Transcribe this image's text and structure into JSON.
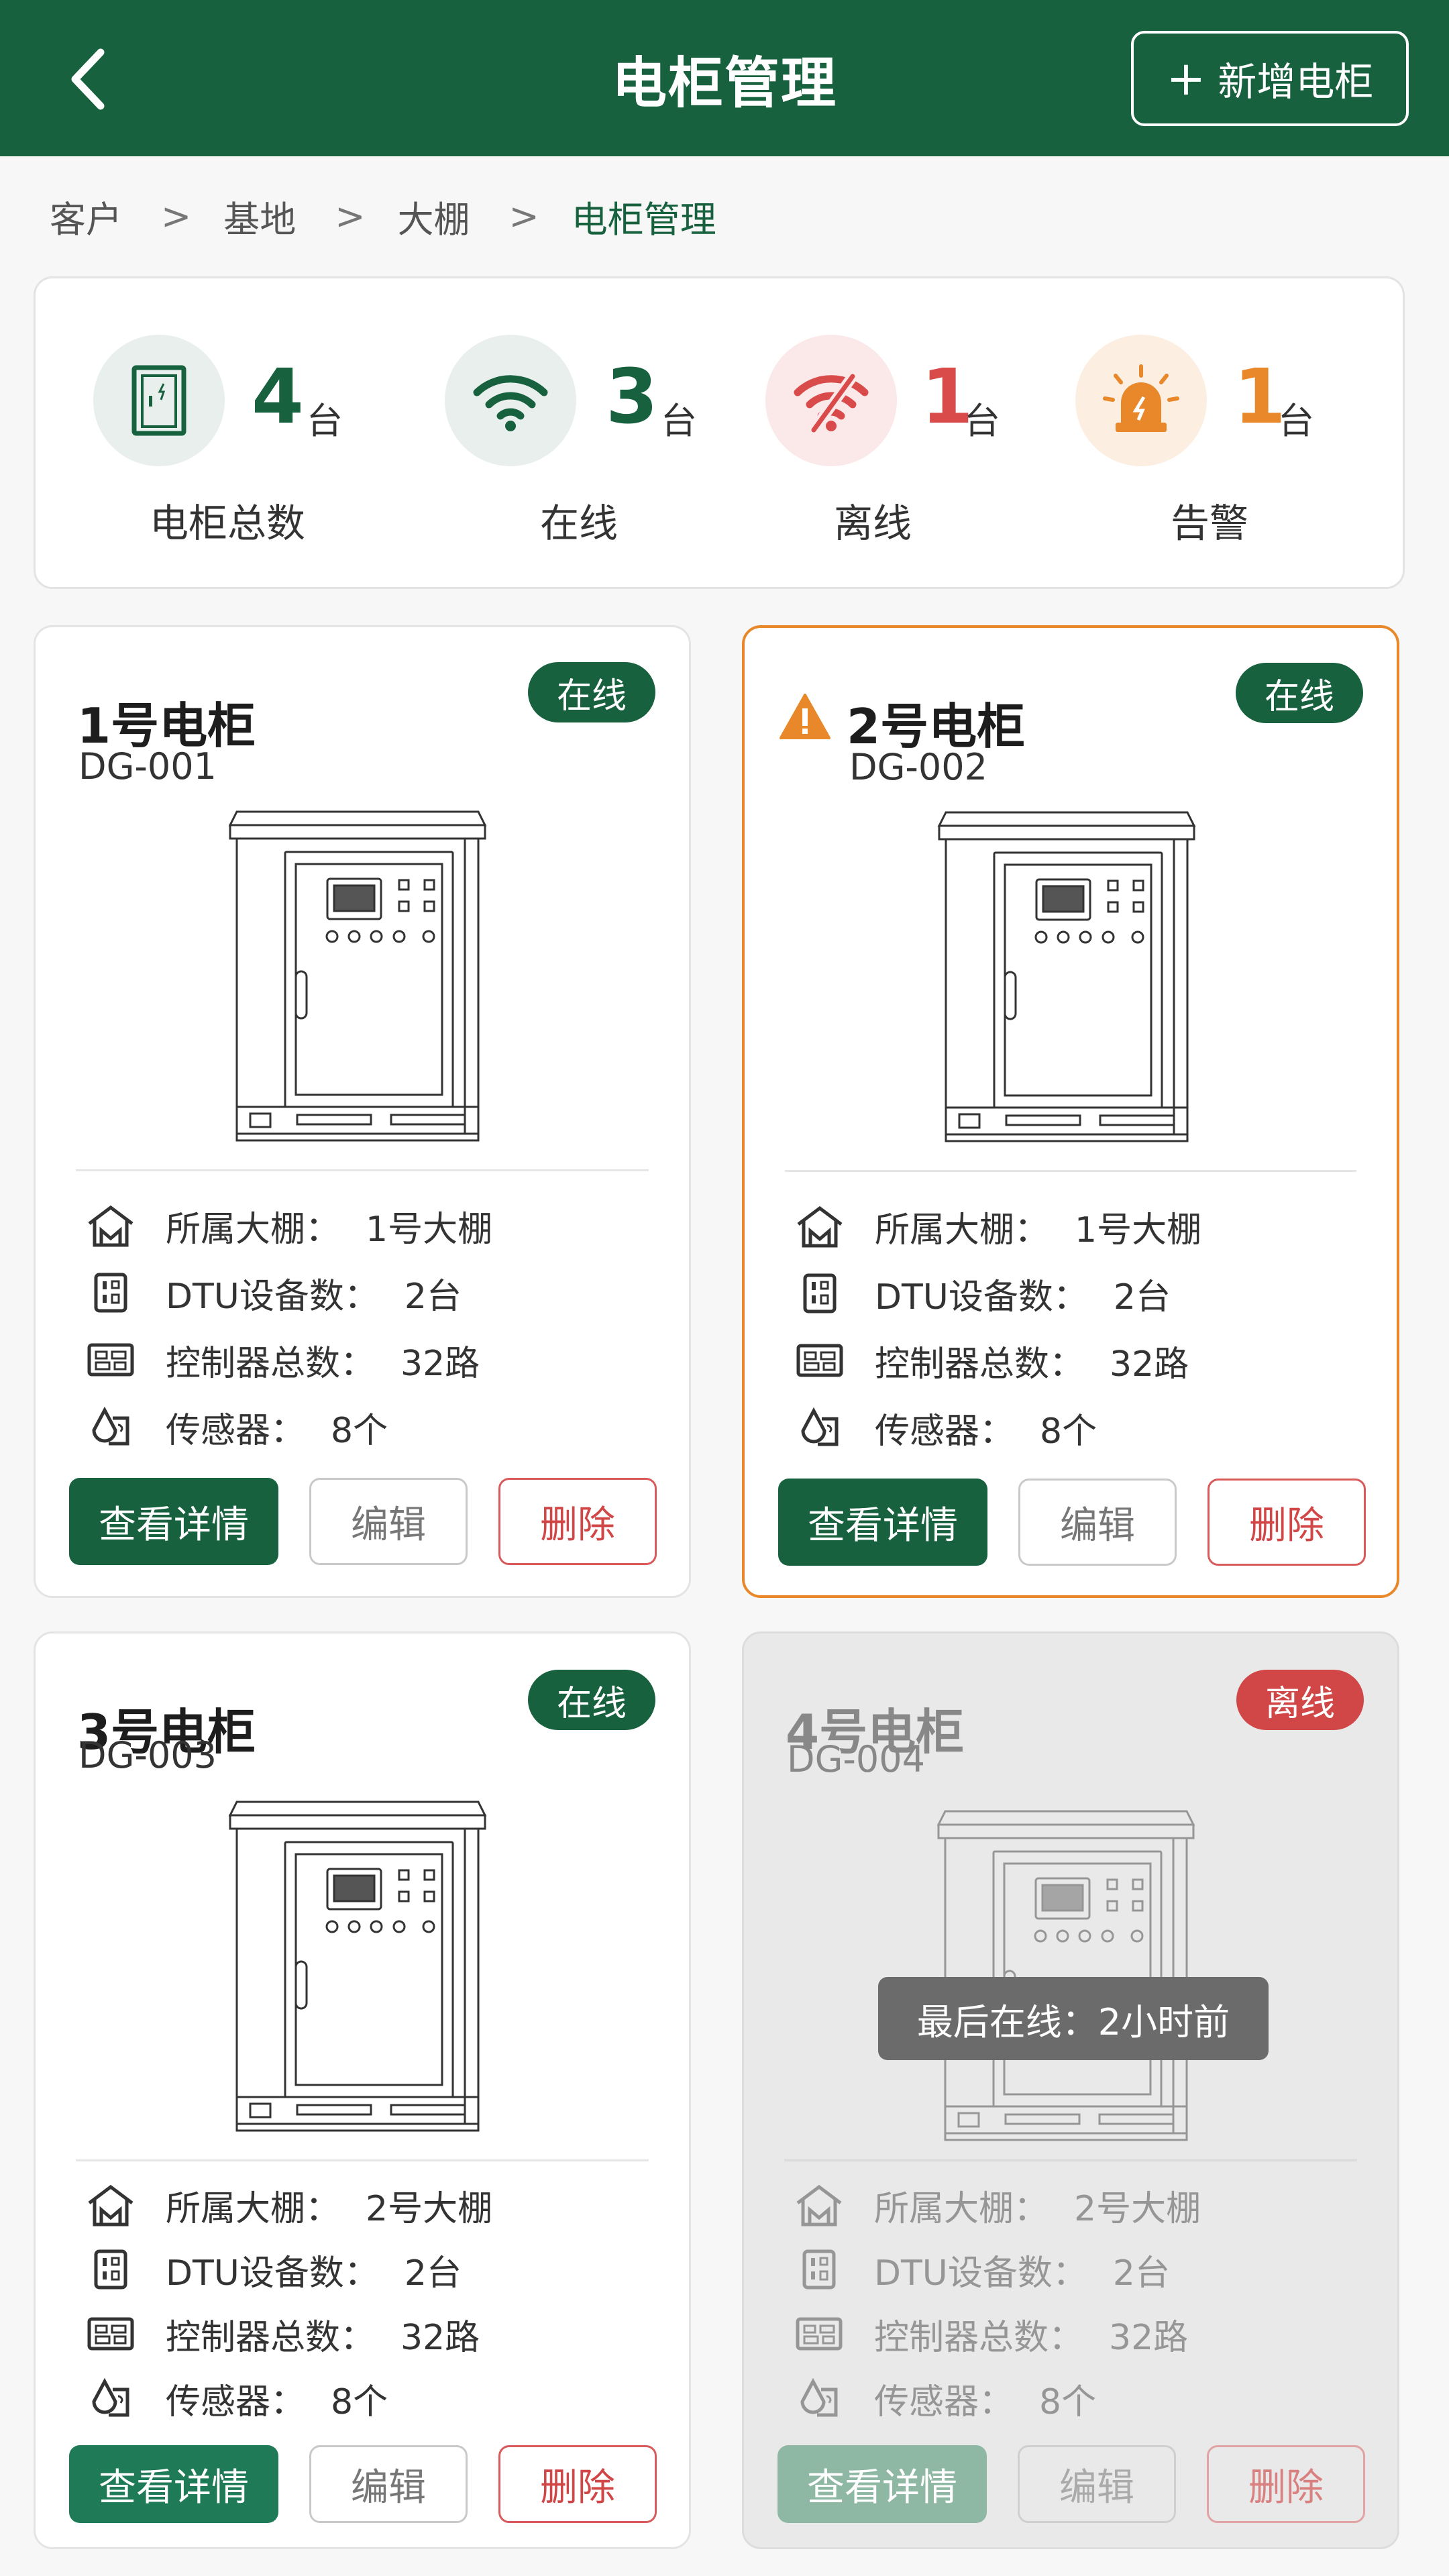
{
  "header": {
    "title": "电柜管理",
    "add_button_label": "新增电柜",
    "add_button_plus": "+"
  },
  "breadcrumb": {
    "items": [
      "客户",
      "基地",
      "大棚",
      "电柜管理"
    ],
    "separator": ">"
  },
  "stats": [
    {
      "value": "4",
      "unit": "台",
      "label": "电柜总数",
      "color": "#17613f",
      "icon": "cabinet-icon"
    },
    {
      "value": "3",
      "unit": "台",
      "label": "在线",
      "color": "#17613f",
      "icon": "wifi-icon"
    },
    {
      "value": "1",
      "unit": "台",
      "label": "离线",
      "color": "#d94b4b",
      "icon": "wifi-off-icon"
    },
    {
      "value": "1",
      "unit": "台",
      "label": "告警",
      "color": "#e8882a",
      "icon": "alarm-icon"
    }
  ],
  "labels": {
    "greenhouse": "所属大棚：",
    "dtu": "DTU设备数：",
    "controllers": "控制器总数：",
    "sensors": "传感器："
  },
  "buttons": {
    "details": "查看详情",
    "edit": "编辑",
    "delete": "删除"
  },
  "cabinets": [
    {
      "name": "1号电柜",
      "code": "DG-001",
      "status": "在线",
      "greenhouse": "1号大棚",
      "dtu": "2台",
      "controllers": "32路",
      "sensors": "8个"
    },
    {
      "name": "2号电柜",
      "code": "DG-002",
      "status": "在线",
      "greenhouse": "1号大棚",
      "dtu": "2台",
      "controllers": "32路",
      "sensors": "8个"
    },
    {
      "name": "3号电柜",
      "code": "DG-003",
      "status": "在线",
      "greenhouse": "2号大棚",
      "dtu": "2台",
      "controllers": "32路",
      "sensors": "8个"
    },
    {
      "name": "4号电柜",
      "code": "DG-004",
      "status": "离线",
      "greenhouse": "2号大棚",
      "dtu": "2台",
      "controllers": "32路",
      "sensors": "8个",
      "last_online": "最后在线：2小时前"
    }
  ],
  "colors": {
    "primary": "#17613f",
    "warning": "#e8882a",
    "danger": "#d14646"
  }
}
